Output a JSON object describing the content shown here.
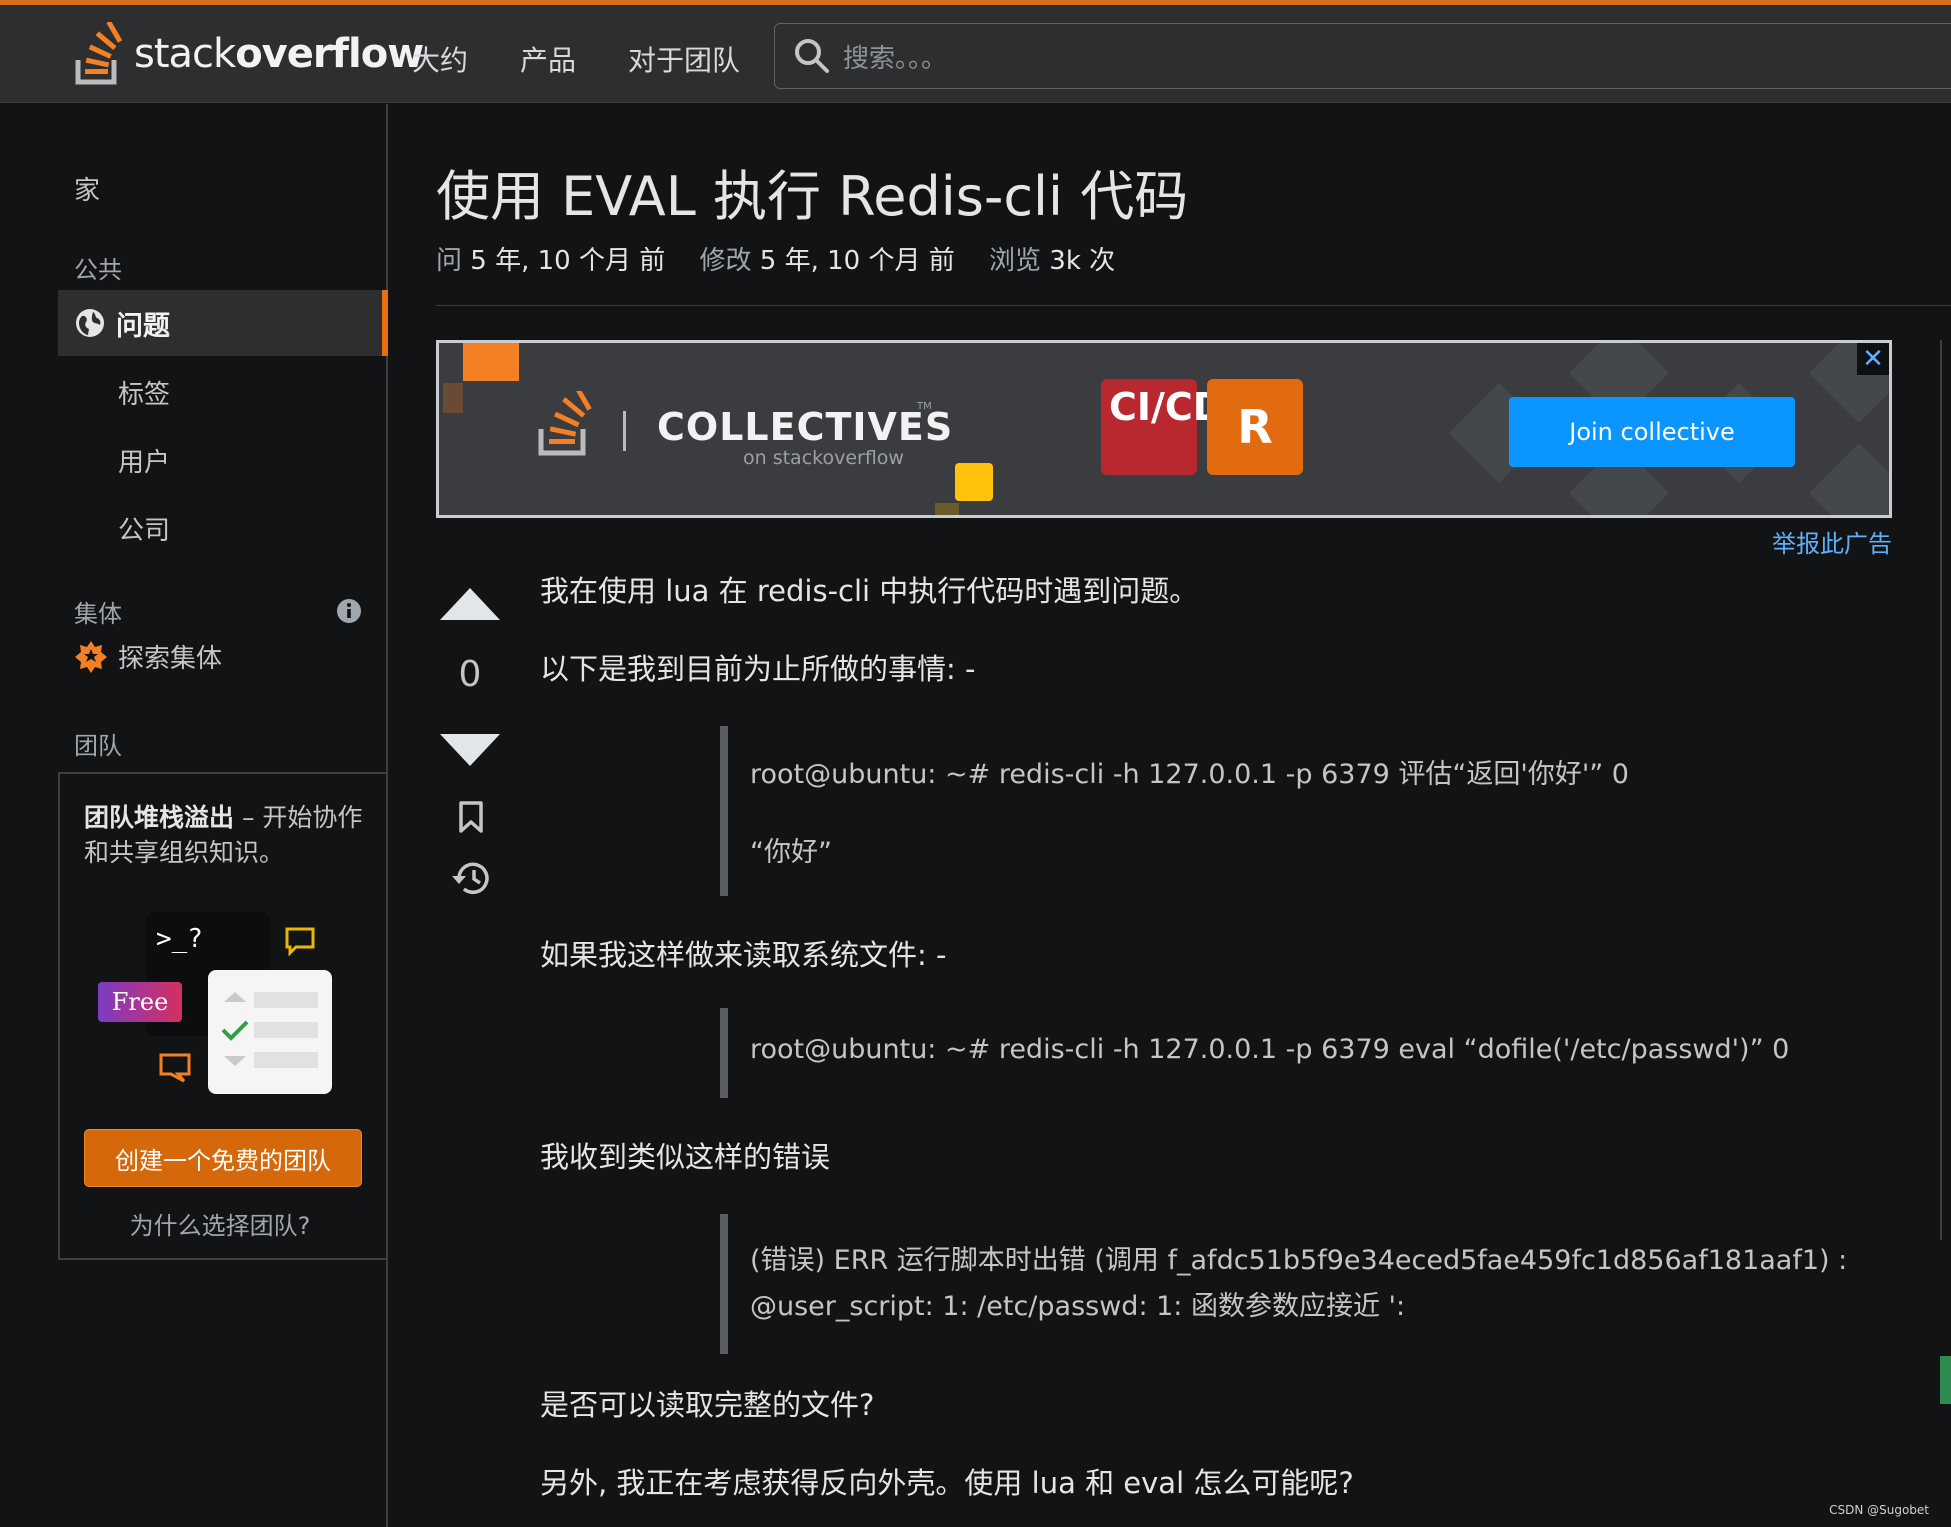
{
  "nav": {
    "logo_light": "stack",
    "logo_bold": "overflow",
    "about": "大约",
    "products": "产品",
    "for_teams": "对于团队",
    "search_placeholder": "搜索。。。"
  },
  "sidebar": {
    "home": "家",
    "public_label": "公共",
    "questions": "问题",
    "tags": "标签",
    "users": "用户",
    "companies": "公司",
    "collectives_label": "集体",
    "explore_collectives": "探索集体",
    "teams_label": "团队",
    "teams_promo_bold": "团队堆栈溢出",
    "teams_promo_rest": " – 开始协作和共享组织知识。",
    "free_badge": "Free",
    "terminal_prompt": ">_?",
    "create_team": "创建一个免费的团队",
    "why_teams": "为什么选择团队?"
  },
  "question": {
    "title": "使用 EVAL 执行 Redis-cli 代码",
    "asked_label": "问",
    "asked_value": "5 年, 10 个月 前",
    "modified_label": "修改",
    "modified_value": "5 年, 10 个月 前",
    "viewed_label": "浏览",
    "viewed_value": "3k 次",
    "score": "0"
  },
  "ad": {
    "brand": "COLLECTIVES",
    "tm": "TM",
    "sub": "on stackoverflow",
    "tile1": "CI/CD",
    "tile2": "R",
    "join": "Join collective",
    "close": "✕",
    "report": "举报此广告"
  },
  "post": {
    "p1": "我在使用 lua 在 redis-cli 中执行代码时遇到问题。",
    "p2": "以下是我到目前为止所做的事情: -",
    "q1_line1": "root@ubuntu: ~# redis-cli -h 127.0.0.1 -p 6379 评估“返回'你好'” 0",
    "q1_line2": "“你好”",
    "p3": "如果我这样做来读取系统文件: -",
    "q2_line1": "root@ubuntu: ~# redis-cli -h 127.0.0.1 -p 6379 eval “dofile('/etc/passwd')” 0",
    "p4": "我收到类似这样的错误",
    "q3_line1": "(错误) ERR 运行脚本时出错 (调用 f_afdc51b5f9e34eced5fae459fc1d856af181aaf1) :",
    "q3_line2": "@user_script: 1: /etc/passwd: 1: 函数参数应接近 ':",
    "p5": "是否可以读取完整的文件?",
    "p6": "另外, 我正在考虑获得反向外壳。使用 lua 和 eval 怎么可能呢?"
  },
  "watermark": "CSDN @Sugobet"
}
